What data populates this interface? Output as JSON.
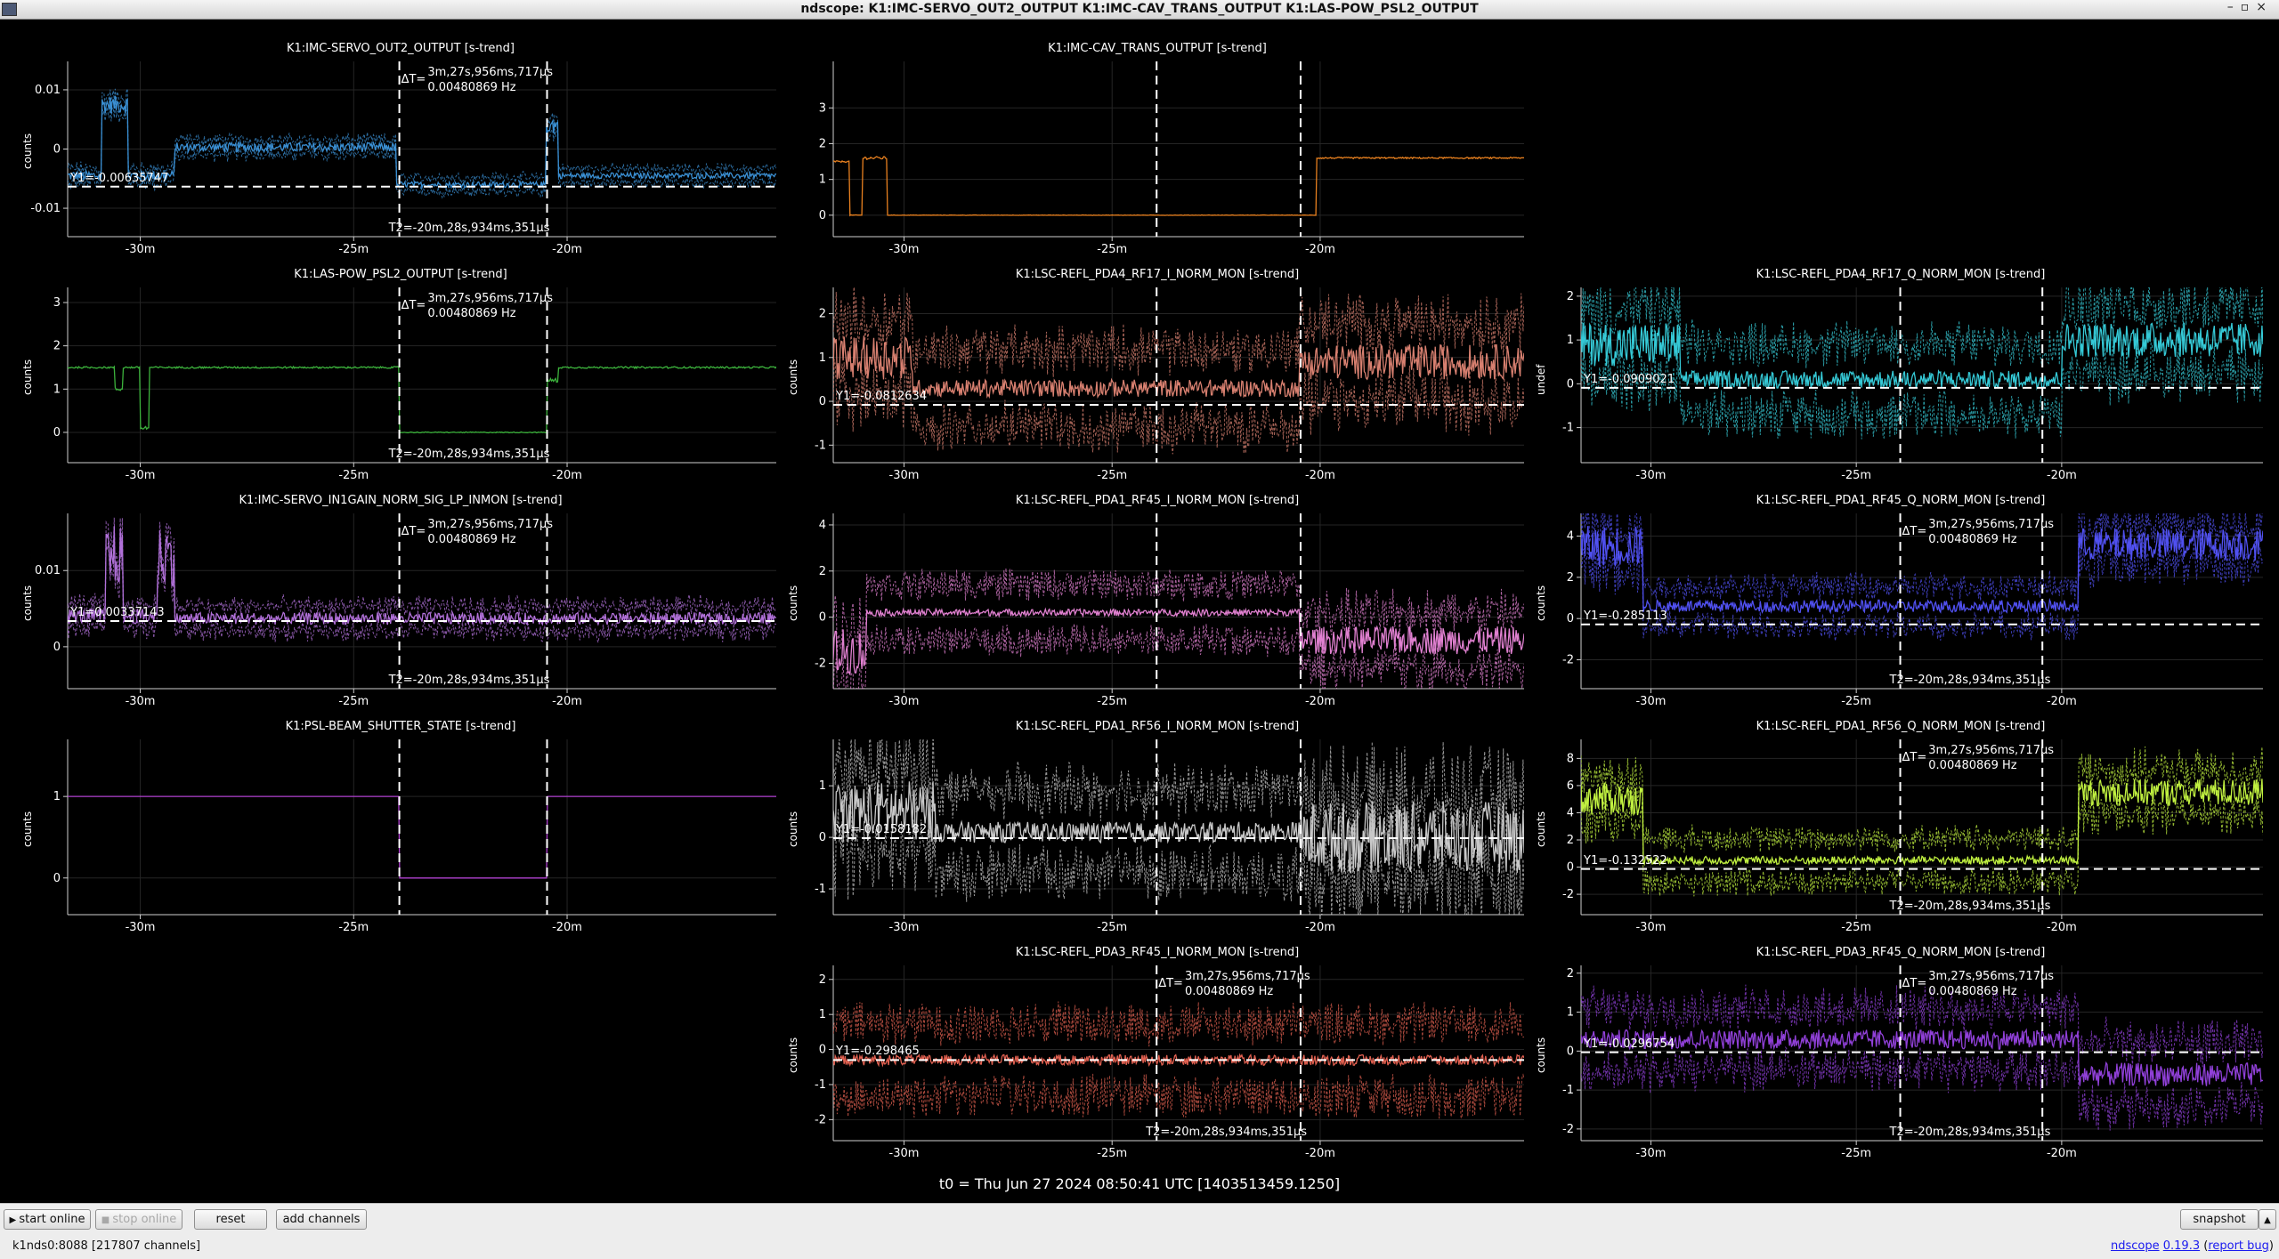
{
  "window": {
    "title": "ndscope: K1:IMC-SERVO_OUT2_OUTPUT K1:IMC-CAV_TRANS_OUTPUT K1:LAS-POW_PSL2_OUTPUT",
    "buttons_icon": "window-controls-icon"
  },
  "cursor": {
    "dt": "3m,27s,956ms,717μs",
    "freq": "0.00480869 Hz",
    "t2": "T2=-20m,28s,934ms,351μs",
    "dt_prefix": "ΔT="
  },
  "xaxis": {
    "range_minutes": [
      -31.7,
      -15.1
    ],
    "ticks": [
      -30,
      -25,
      -20
    ],
    "tick_labels": [
      "-30m",
      "-25m",
      "-20m"
    ],
    "cursor1_min": -23.93,
    "cursor2_min": -20.47
  },
  "plots": [
    {
      "id": "imc-servo-out2",
      "title": "K1:IMC-SERVO_OUT2_OUTPUT [s-trend]",
      "ylabel": "counts",
      "color": "#3a8fd3",
      "ytick_labels": [
        "0.01",
        "0",
        "-0.01"
      ],
      "ytick_values": [
        0.01,
        0,
        -0.01
      ],
      "yrange": [
        -0.0148,
        0.0148
      ],
      "y1": "Y1=-0.00635747",
      "y1_value": -0.00635747,
      "trace": [
        {
          "from": -31.7,
          "to": -30.9,
          "val": -0.0045,
          "noise": 0.0009
        },
        {
          "from": -30.9,
          "to": -30.3,
          "val": 0.0075,
          "noise": 0.0015
        },
        {
          "from": -30.3,
          "to": -29.2,
          "val": -0.0045,
          "noise": 0.0009
        },
        {
          "from": -29.2,
          "to": -24.0,
          "val": 0.0003,
          "noise": 0.0008
        },
        {
          "from": -24.0,
          "to": -20.5,
          "val": -0.006,
          "noise": 0.0005
        },
        {
          "from": -20.5,
          "to": -20.2,
          "val": 0.004,
          "noise": 0.0015
        },
        {
          "from": -20.2,
          "to": -15.1,
          "val": -0.0045,
          "noise": 0.0005
        }
      ],
      "band": 0.0015,
      "show_dt": true
    },
    {
      "id": "imc-cav-trans",
      "title": "K1:IMC-CAV_TRANS_OUTPUT [s-trend]",
      "ylabel": "",
      "color": "#e8801f",
      "ytick_labels": [
        "3",
        "2",
        "1",
        "0"
      ],
      "ytick_values": [
        3,
        2,
        1,
        0
      ],
      "yrange": [
        -0.6,
        4.3
      ],
      "y1": "",
      "trace": [
        {
          "from": -31.7,
          "to": -31.3,
          "val": 1.5,
          "noise": 0.02
        },
        {
          "from": -31.3,
          "to": -31.0,
          "val": 0.0,
          "noise": 0.01
        },
        {
          "from": -31.0,
          "to": -30.4,
          "val": 1.6,
          "noise": 0.04
        },
        {
          "from": -30.4,
          "to": -20.1,
          "val": 0.0,
          "noise": 0.005
        },
        {
          "from": -20.1,
          "to": -15.1,
          "val": 1.6,
          "noise": 0.02
        }
      ],
      "band": 0,
      "show_dt": false
    },
    {
      "id": "las-pow-psl2",
      "title": "K1:LAS-POW_PSL2_OUTPUT [s-trend]",
      "ylabel": "counts",
      "color": "#3cb23c",
      "ytick_labels": [
        "3",
        "2",
        "1",
        "0"
      ],
      "ytick_values": [
        3,
        2,
        1,
        0
      ],
      "yrange": [
        -0.7,
        3.35
      ],
      "y1": "",
      "trace": [
        {
          "from": -31.7,
          "to": -30.6,
          "val": 1.5,
          "noise": 0.02
        },
        {
          "from": -30.6,
          "to": -30.4,
          "val": 1.0,
          "noise": 0.05
        },
        {
          "from": -30.4,
          "to": -30.0,
          "val": 1.5,
          "noise": 0.02
        },
        {
          "from": -30.0,
          "to": -29.8,
          "val": 0.1,
          "noise": 0.05
        },
        {
          "from": -29.8,
          "to": -23.93,
          "val": 1.5,
          "noise": 0.02
        },
        {
          "from": -23.93,
          "to": -20.47,
          "val": 0.0,
          "noise": 0.01
        },
        {
          "from": -20.47,
          "to": -20.2,
          "val": 1.2,
          "noise": 0.05
        },
        {
          "from": -20.2,
          "to": -15.1,
          "val": 1.5,
          "noise": 0.02
        }
      ],
      "band": 0,
      "show_dt": true
    },
    {
      "id": "refl-pda4-rf17-i",
      "title": "K1:LSC-REFL_PDA4_RF17_I_NORM_MON [s-trend]",
      "ylabel": "counts",
      "color": "#d88070",
      "ytick_labels": [
        "2",
        "1",
        "0",
        "-1"
      ],
      "ytick_values": [
        2,
        1,
        0,
        -1
      ],
      "yrange": [
        -1.4,
        2.6
      ],
      "y1": "Y1=-0.0812634",
      "y1_value": -0.0812634,
      "trace": [
        {
          "from": -31.7,
          "to": -29.8,
          "val": 1.0,
          "noise": 0.5
        },
        {
          "from": -29.8,
          "to": -20.5,
          "val": 0.3,
          "noise": 0.2
        },
        {
          "from": -20.5,
          "to": -15.1,
          "val": 0.9,
          "noise": 0.4
        }
      ],
      "band": 1.1,
      "show_dt": false
    },
    {
      "id": "refl-pda4-rf17-q",
      "title": "K1:LSC-REFL_PDA4_RF17_Q_NORM_MON [s-trend]",
      "ylabel": "undef",
      "color": "#35c9d6",
      "ytick_labels": [
        "2",
        "1",
        "0",
        "-1"
      ],
      "ytick_values": [
        2,
        1,
        0,
        -1
      ],
      "yrange": [
        -1.8,
        2.2
      ],
      "y1": "Y1=-0.0909021",
      "y1_value": -0.0909021,
      "trace": [
        {
          "from": -31.7,
          "to": -29.3,
          "val": 0.9,
          "noise": 0.5
        },
        {
          "from": -29.3,
          "to": -20.0,
          "val": 0.1,
          "noise": 0.2
        },
        {
          "from": -20.0,
          "to": -15.1,
          "val": 1.0,
          "noise": 0.4
        }
      ],
      "band": 1.0,
      "show_dt": false
    },
    {
      "id": "imc-servo-in1gain",
      "title": "K1:IMC-SERVO_IN1GAIN_NORM_SIG_LP_INMON [s-trend]",
      "ylabel": "counts",
      "color": "#b070d8",
      "ytick_labels": [
        "0.01",
        "0"
      ],
      "ytick_values": [
        0.01,
        0
      ],
      "yrange": [
        -0.0055,
        0.0175
      ],
      "y1": "Y1=0.00337143",
      "y1_value": 0.00337143,
      "trace": [
        {
          "from": -31.7,
          "to": -30.8,
          "val": 0.004,
          "noise": 0.001
        },
        {
          "from": -30.8,
          "to": -30.4,
          "val": 0.012,
          "noise": 0.004
        },
        {
          "from": -30.4,
          "to": -29.6,
          "val": 0.004,
          "noise": 0.001
        },
        {
          "from": -29.6,
          "to": -29.2,
          "val": 0.012,
          "noise": 0.004
        },
        {
          "from": -29.2,
          "to": -15.1,
          "val": 0.0037,
          "noise": 0.0008
        }
      ],
      "band": 0.002,
      "show_dt": true
    },
    {
      "id": "refl-pda1-rf45-i",
      "title": "K1:LSC-REFL_PDA1_RF45_I_NORM_MON [s-trend]",
      "ylabel": "counts",
      "color": "#e080d0",
      "ytick_labels": [
        "4",
        "2",
        "0",
        "-2"
      ],
      "ytick_values": [
        4,
        2,
        0,
        -2
      ],
      "yrange": [
        -3.1,
        4.5
      ],
      "y1": "",
      "trace": [
        {
          "from": -31.7,
          "to": -30.9,
          "val": -1.5,
          "noise": 1.0
        },
        {
          "from": -30.9,
          "to": -20.5,
          "val": 0.2,
          "noise": 0.15
        },
        {
          "from": -20.5,
          "to": -15.1,
          "val": -1.0,
          "noise": 0.6
        }
      ],
      "band": 1.5,
      "show_dt": false
    },
    {
      "id": "refl-pda1-rf45-q",
      "title": "K1:LSC-REFL_PDA1_RF45_Q_NORM_MON [s-trend]",
      "ylabel": "counts",
      "color": "#5050f0",
      "ytick_labels": [
        "4",
        "2",
        "0",
        "-2"
      ],
      "ytick_values": [
        4,
        2,
        0,
        -2
      ],
      "yrange": [
        -3.4,
        5.1
      ],
      "y1": "Y1=-0.285113",
      "y1_value": -0.285113,
      "trace": [
        {
          "from": -31.7,
          "to": -30.2,
          "val": 3.5,
          "noise": 1.0
        },
        {
          "from": -30.2,
          "to": -19.6,
          "val": 0.6,
          "noise": 0.3
        },
        {
          "from": -19.6,
          "to": -15.1,
          "val": 3.6,
          "noise": 0.8
        }
      ],
      "band": 1.2,
      "show_dt": true
    },
    {
      "id": "psl-beam-shutter",
      "title": "K1:PSL-BEAM_SHUTTER_STATE [s-trend]",
      "ylabel": "counts",
      "color": "#b040d0",
      "ytick_labels": [
        "1",
        "0"
      ],
      "ytick_values": [
        1,
        0
      ],
      "yrange": [
        -0.45,
        1.7
      ],
      "y1": "",
      "trace": [
        {
          "from": -31.7,
          "to": -23.93,
          "val": 1.0,
          "noise": 0
        },
        {
          "from": -23.93,
          "to": -20.47,
          "val": 0.0,
          "noise": 0
        },
        {
          "from": -20.47,
          "to": -15.1,
          "val": 1.0,
          "noise": 0
        }
      ],
      "band": 0,
      "show_dt": false
    },
    {
      "id": "refl-pda1-rf56-i",
      "title": "K1:LSC-REFL_PDA1_RF56_I_NORM_MON [s-trend]",
      "ylabel": "counts",
      "color": "#c8c8c8",
      "ytick_labels": [
        "1",
        "0",
        "-1"
      ],
      "ytick_values": [
        1,
        0,
        -1
      ],
      "yrange": [
        -1.5,
        1.9
      ],
      "y1": "Y1=-0.0158182",
      "y1_value": -0.0158182,
      "trace": [
        {
          "from": -31.7,
          "to": -29.2,
          "val": 0.5,
          "noise": 0.6
        },
        {
          "from": -29.2,
          "to": -20.5,
          "val": 0.1,
          "noise": 0.2
        },
        {
          "from": -20.5,
          "to": -15.1,
          "val": 0.0,
          "noise": 0.7
        }
      ],
      "band": 1.0,
      "show_dt": false
    },
    {
      "id": "refl-pda1-rf56-q",
      "title": "K1:LSC-REFL_PDA1_RF56_Q_NORM_MON [s-trend]",
      "ylabel": "counts",
      "color": "#c0f040",
      "ytick_labels": [
        "8",
        "6",
        "4",
        "2",
        "0",
        "-2"
      ],
      "ytick_values": [
        8,
        6,
        4,
        2,
        0,
        -2
      ],
      "yrange": [
        -3.5,
        9.4
      ],
      "y1": "Y1=-0.132522",
      "y1_value": -0.132522,
      "trace": [
        {
          "from": -31.7,
          "to": -30.2,
          "val": 5.0,
          "noise": 1.2
        },
        {
          "from": -30.2,
          "to": -19.6,
          "val": 0.5,
          "noise": 0.3
        },
        {
          "from": -19.6,
          "to": -15.1,
          "val": 5.5,
          "noise": 1.0
        }
      ],
      "band": 2.0,
      "show_dt": true
    },
    {
      "id": "refl-pda3-rf45-i",
      "title": "K1:LSC-REFL_PDA3_RF45_I_NORM_MON [s-trend]",
      "ylabel": "counts",
      "color": "#e06050",
      "ytick_labels": [
        "2",
        "1",
        "0",
        "-1",
        "-2"
      ],
      "ytick_values": [
        2,
        1,
        0,
        -1,
        -2
      ],
      "yrange": [
        -2.6,
        2.4
      ],
      "y1": "Y1=-0.298465",
      "y1_value": -0.298465,
      "trace": [
        {
          "from": -31.7,
          "to": -15.1,
          "val": -0.3,
          "noise": 0.15
        }
      ],
      "band": 1.3,
      "show_dt": true
    },
    {
      "id": "refl-pda3-rf45-q",
      "title": "K1:LSC-REFL_PDA3_RF45_Q_NORM_MON [s-trend]",
      "ylabel": "counts",
      "color": "#9040d8",
      "ytick_labels": [
        "2",
        "1",
        "0",
        "-1",
        "-2"
      ],
      "ytick_values": [
        2,
        1,
        0,
        -1,
        -2
      ],
      "yrange": [
        -2.3,
        2.2
      ],
      "y1": "Y1=-0.0296754",
      "y1_value": -0.0296754,
      "trace": [
        {
          "from": -31.7,
          "to": -19.6,
          "val": 0.3,
          "noise": 0.25
        },
        {
          "from": -19.6,
          "to": -15.1,
          "val": -0.6,
          "noise": 0.3
        }
      ],
      "band": 1.0,
      "show_dt": true
    }
  ],
  "t0": "t0 = Thu Jun 27 2024 08:50:41 UTC [1403513459.1250]",
  "toolbar": {
    "start_online": "start online",
    "stop_online": "stop online",
    "reset": "reset",
    "add_channels": "add channels",
    "snapshot": "snapshot"
  },
  "status": {
    "server": "k1nds0:8088 [217807 channels]",
    "ndscope_link": "ndscope",
    "version_link": "0.19.3",
    "report_bug_link": "report bug",
    "open_paren": " (",
    "close_paren": ")"
  }
}
